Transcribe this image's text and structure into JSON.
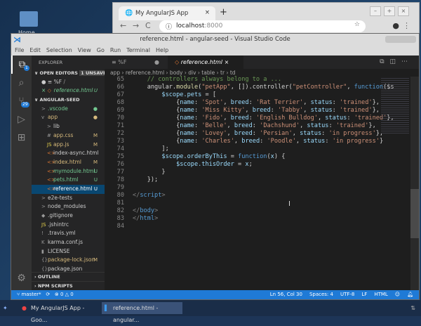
{
  "desktop": {
    "home_label": "Home"
  },
  "browser": {
    "tab_title": "My AngularJS App",
    "url_host": "localhost",
    "url_port": ":8000"
  },
  "vscode": {
    "title": "reference.html - angular-seed - Visual Studio Code",
    "menu": [
      "File",
      "Edit",
      "Selection",
      "View",
      "Go",
      "Run",
      "Terminal",
      "Help"
    ],
    "scm_badge": "29",
    "explorer_badge": "1",
    "explorer_title": "EXPLORER",
    "open_editors": {
      "label": "OPEN EDITORS",
      "unsaved": "1 UNSAVED",
      "items": [
        {
          "name": "%F",
          "path": "/"
        },
        {
          "name": "reference.html",
          "status": "U"
        }
      ]
    },
    "project": "ANGULAR-SEED",
    "tree": [
      {
        "name": ".vscode",
        "icon": ">",
        "pad": 14,
        "status": "●",
        "color": "#73c991"
      },
      {
        "name": "app",
        "icon": "v",
        "pad": 14,
        "status": "●",
        "color": "#d7ba7d"
      },
      {
        "name": "lib",
        "icon": ">",
        "pad": 22,
        "status": "",
        "color": "#ccc"
      },
      {
        "name": "app.css",
        "icon": "#",
        "pad": 22,
        "status": "M",
        "color": "#d7ba7d"
      },
      {
        "name": "app.js",
        "icon": "JS",
        "pad": 22,
        "status": "M",
        "color": "#d7ba7d"
      },
      {
        "name": "index-async.html",
        "icon": "<>",
        "pad": 22,
        "status": "",
        "color": "#ccc"
      },
      {
        "name": "index.html",
        "icon": "<>",
        "pad": 22,
        "status": "M",
        "color": "#d7ba7d"
      },
      {
        "name": "mymodule.html",
        "icon": "<>",
        "pad": 22,
        "status": "U",
        "color": "#73c991"
      },
      {
        "name": "pets.html",
        "icon": "<>",
        "pad": 22,
        "status": "U",
        "color": "#73c991"
      },
      {
        "name": "reference.html",
        "icon": "<>",
        "pad": 22,
        "status": "U",
        "color": "#ffffff",
        "selected": true
      },
      {
        "name": "e2e-tests",
        "icon": ">",
        "pad": 14,
        "status": "",
        "color": "#ccc"
      },
      {
        "name": "node_modules",
        "icon": ">",
        "pad": 14,
        "status": "",
        "color": "#ccc"
      },
      {
        "name": ".gitignore",
        "icon": "◆",
        "pad": 14,
        "status": "",
        "color": "#ccc"
      },
      {
        "name": ".jshintrc",
        "icon": "JS",
        "pad": 14,
        "status": "",
        "color": "#ccc"
      },
      {
        "name": ".travis.yml",
        "icon": "!",
        "pad": 14,
        "status": "",
        "color": "#ccc"
      },
      {
        "name": "karma.conf.js",
        "icon": "K",
        "pad": 14,
        "status": "",
        "color": "#ccc"
      },
      {
        "name": "LICENSE",
        "icon": "▮",
        "pad": 14,
        "status": "",
        "color": "#ccc"
      },
      {
        "name": "package-lock.json",
        "icon": "{}",
        "pad": 14,
        "status": "M",
        "color": "#d7ba7d"
      },
      {
        "name": "package.json",
        "icon": "{}",
        "pad": 14,
        "status": "",
        "color": "#ccc"
      }
    ],
    "outline": "OUTLINE",
    "npm": "NPM SCRIPTS",
    "tabs": [
      {
        "label": "%F",
        "dirty": "●"
      },
      {
        "label": "reference.html",
        "close": "×"
      }
    ],
    "breadcrumb": "app › reference.html › body › div › table › tr › td",
    "code": [
      {
        "n": "65",
        "t": [
          [
            "cm",
            "    // controllers always belong to a ..."
          ]
        ]
      },
      {
        "n": "66",
        "t": [
          [
            "",
            "    angular."
          ],
          [
            "fn",
            "module"
          ],
          [
            "",
            "("
          ],
          [
            "str",
            "\"petApp\""
          ],
          [
            "",
            ", []).controller("
          ],
          [
            "str",
            "\"petController\""
          ],
          [
            "",
            ", "
          ],
          [
            "kw",
            "function"
          ],
          [
            "",
            "($s"
          ]
        ]
      },
      {
        "n": "67",
        "t": [
          [
            "prop",
            "        $scope.pets"
          ],
          [
            "",
            " = ["
          ]
        ]
      },
      {
        "n": "68",
        "t": [
          [
            "",
            "            {"
          ],
          [
            "prop",
            "name"
          ],
          [
            "",
            ": "
          ],
          [
            "str",
            "'Spot'"
          ],
          [
            "",
            ", "
          ],
          [
            "prop",
            "breed"
          ],
          [
            "",
            ": "
          ],
          [
            "str",
            "'Rat Terrier'"
          ],
          [
            "",
            ", "
          ],
          [
            "prop",
            "status"
          ],
          [
            "",
            ": "
          ],
          [
            "str",
            "'trained'"
          ],
          [
            "",
            "},"
          ]
        ]
      },
      {
        "n": "69",
        "t": [
          [
            "",
            "            {"
          ],
          [
            "prop",
            "name"
          ],
          [
            "",
            ": "
          ],
          [
            "str",
            "'Miss Kitty'"
          ],
          [
            "",
            ", "
          ],
          [
            "prop",
            "breed"
          ],
          [
            "",
            ": "
          ],
          [
            "str",
            "'Tabby'"
          ],
          [
            "",
            ", "
          ],
          [
            "prop",
            "status"
          ],
          [
            "",
            ": "
          ],
          [
            "str",
            "'trained'"
          ],
          [
            "",
            "},"
          ]
        ]
      },
      {
        "n": "70",
        "t": [
          [
            "",
            "            {"
          ],
          [
            "prop",
            "name"
          ],
          [
            "",
            ": "
          ],
          [
            "str",
            "'Fido'"
          ],
          [
            "",
            ", "
          ],
          [
            "prop",
            "breed"
          ],
          [
            "",
            ": "
          ],
          [
            "str",
            "'English Bulldog'"
          ],
          [
            "",
            ", "
          ],
          [
            "prop",
            "status"
          ],
          [
            "",
            ": "
          ],
          [
            "str",
            "'trained'"
          ],
          [
            "",
            "},"
          ]
        ]
      },
      {
        "n": "71",
        "t": [
          [
            "",
            "            {"
          ],
          [
            "prop",
            "name"
          ],
          [
            "",
            ": "
          ],
          [
            "str",
            "'Belle'"
          ],
          [
            "",
            ", "
          ],
          [
            "prop",
            "breed"
          ],
          [
            "",
            ": "
          ],
          [
            "str",
            "'Dachshund'"
          ],
          [
            "",
            ", "
          ],
          [
            "prop",
            "status"
          ],
          [
            "",
            ": "
          ],
          [
            "str",
            "'trained'"
          ],
          [
            "",
            "},"
          ]
        ]
      },
      {
        "n": "72",
        "t": [
          [
            "",
            "            {"
          ],
          [
            "prop",
            "name"
          ],
          [
            "",
            ": "
          ],
          [
            "str",
            "'Lovey'"
          ],
          [
            "",
            ", "
          ],
          [
            "prop",
            "breed"
          ],
          [
            "",
            ": "
          ],
          [
            "str",
            "'Persian'"
          ],
          [
            "",
            ", "
          ],
          [
            "prop",
            "status"
          ],
          [
            "",
            ": "
          ],
          [
            "str",
            "'in progress'"
          ],
          [
            "",
            "},"
          ]
        ]
      },
      {
        "n": "73",
        "t": [
          [
            "",
            "            {"
          ],
          [
            "prop",
            "name"
          ],
          [
            "",
            ": "
          ],
          [
            "str",
            "'Charles'"
          ],
          [
            "",
            ", "
          ],
          [
            "prop",
            "breed"
          ],
          [
            "",
            ": "
          ],
          [
            "str",
            "'Poodle'"
          ],
          [
            "",
            ", "
          ],
          [
            "prop",
            "status"
          ],
          [
            "",
            ": "
          ],
          [
            "str",
            "'in progress'"
          ],
          [
            "",
            "}"
          ]
        ]
      },
      {
        "n": "74",
        "t": [
          [
            "",
            "        ];"
          ]
        ]
      },
      {
        "n": "75",
        "t": [
          [
            "prop",
            "        $scope.orderByThis"
          ],
          [
            "",
            " = "
          ],
          [
            "kw",
            "function"
          ],
          [
            "",
            "("
          ],
          [
            "prop",
            "x"
          ],
          [
            "",
            ") {"
          ]
        ]
      },
      {
        "n": "76",
        "t": [
          [
            "prop",
            "            $scope.thisOrder"
          ],
          [
            "",
            " = "
          ],
          [
            "prop",
            "x"
          ],
          [
            "",
            ";"
          ]
        ]
      },
      {
        "n": "77",
        "t": [
          [
            "",
            "        }"
          ]
        ]
      },
      {
        "n": "78",
        "t": [
          [
            "",
            "    });"
          ]
        ]
      },
      {
        "n": "79",
        "t": []
      },
      {
        "n": "80",
        "t": [
          [
            "pun",
            "</"
          ],
          [
            "tag",
            "script"
          ],
          [
            "pun",
            ">"
          ]
        ]
      },
      {
        "n": "81",
        "t": []
      },
      {
        "n": "82",
        "t": [
          [
            "pun",
            "</"
          ],
          [
            "tag",
            "body"
          ],
          [
            "pun",
            ">"
          ]
        ]
      },
      {
        "n": "83",
        "t": [
          [
            "pun",
            "</"
          ],
          [
            "tag",
            "html"
          ],
          [
            "pun",
            ">"
          ]
        ]
      },
      {
        "n": "84",
        "t": []
      }
    ],
    "status": {
      "branch": "master*",
      "sync": "⟳",
      "problems": "⊗ 0 △ 0",
      "position": "Ln 56, Col 30",
      "spaces": "Spaces: 4",
      "encoding": "UTF-8",
      "eol": "LF",
      "language": "HTML"
    }
  },
  "taskbar": {
    "items": [
      "My AngularJS App - Goo...",
      "reference.html - angular..."
    ]
  }
}
